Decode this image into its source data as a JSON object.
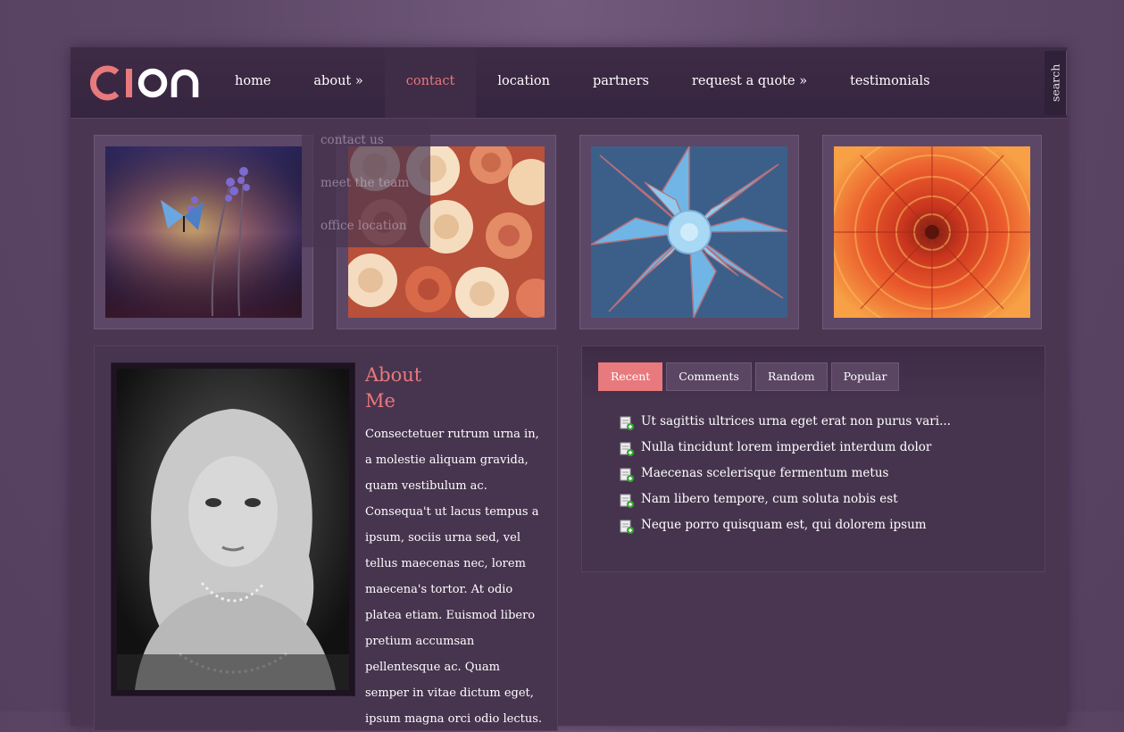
{
  "header": {
    "logo_text": "CION",
    "nav": [
      {
        "label": "home"
      },
      {
        "label": "about »"
      },
      {
        "label": "contact",
        "active": true
      },
      {
        "label": "location"
      },
      {
        "label": "partners"
      },
      {
        "label": "request a quote »"
      },
      {
        "label": "testimonials"
      }
    ],
    "search_label": "search"
  },
  "dropdown": {
    "items": [
      "contact us",
      "meet the team",
      "office location"
    ]
  },
  "gallery": {
    "images": [
      "butterfly on lavender",
      "roses",
      "blue succulent",
      "orange dahlia"
    ]
  },
  "about": {
    "title_line1": "About",
    "title_line2": "Me",
    "text": "Consectetuer rutrum urna in, a molestie aliquam gravida, quam vestibulum ac. Consequa't ut lacus tempus a ipsum, sociis urna sed, vel tellus maecenas nec, lorem maecena's tortor. At odio platea etiam. Euismod libero pretium accumsan pellentesque ac. Quam semper in vitae dictum eget, ipsum magna orci odio lectus."
  },
  "posts": {
    "tabs": [
      "Recent",
      "Comments",
      "Random",
      "Popular"
    ],
    "active_tab": "Recent",
    "items": [
      "Ut sagittis ultrices urna eget erat non purus vari...",
      "Nulla tincidunt lorem imperdiet interdum dolor",
      "Maecenas scelerisque fermentum metus",
      "Nam libero tempore, cum soluta nobis est",
      "Neque porro quisquam est, qui dolorem ipsum"
    ]
  },
  "colors": {
    "accent": "#e8797d",
    "page_bg": "#4b3652",
    "outer_bg": "#5d4767"
  }
}
